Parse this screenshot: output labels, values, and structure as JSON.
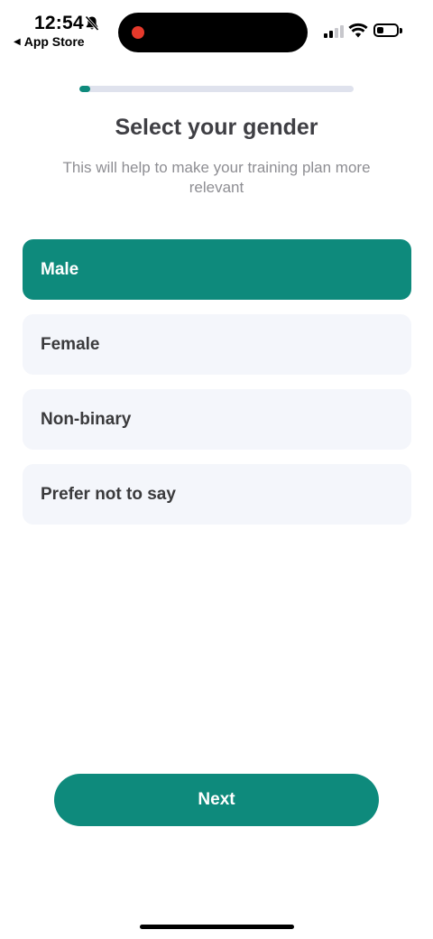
{
  "status_bar": {
    "time": "12:54",
    "back_label": "App Store",
    "back_glyph": "◀",
    "signal_bars_on": 2,
    "signal_bars_total": 4,
    "battery_level": 0.35
  },
  "progress": {
    "value": 0.04
  },
  "header": {
    "title": "Select your gender",
    "subtitle": "This will help to make your training plan more relevant"
  },
  "options": [
    {
      "label": "Male",
      "selected": true
    },
    {
      "label": "Female",
      "selected": false
    },
    {
      "label": "Non-binary",
      "selected": false
    },
    {
      "label": "Prefer not to say",
      "selected": false
    }
  ],
  "footer": {
    "next_label": "Next"
  },
  "colors": {
    "accent": "#0e8a7c",
    "option_bg": "#f4f6fb",
    "progress_track": "#dfe2ed",
    "recording_dot": "#e5392b"
  }
}
